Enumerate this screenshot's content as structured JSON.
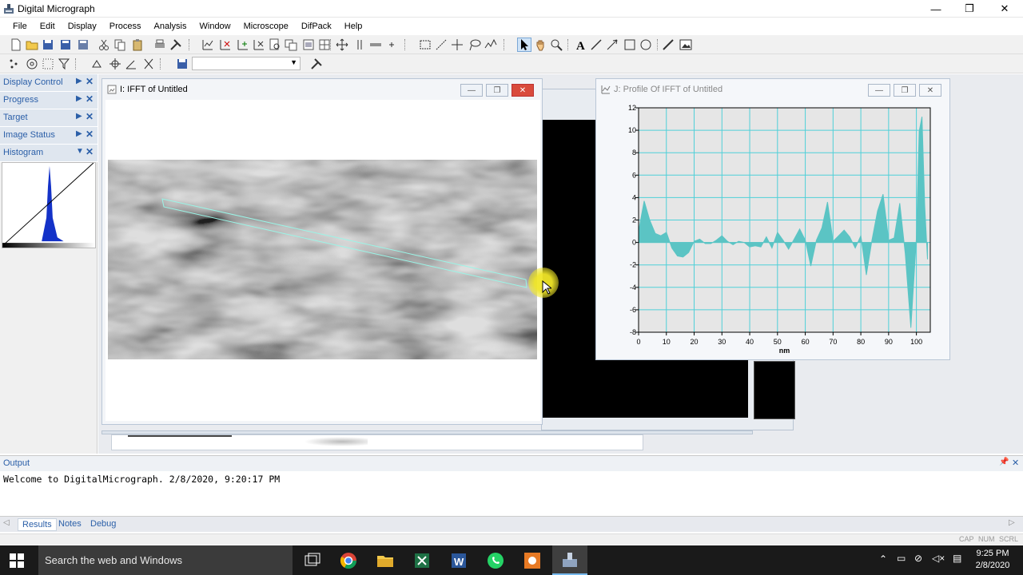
{
  "app": {
    "title": "Digital Micrograph"
  },
  "menu": [
    "File",
    "Edit",
    "Display",
    "Process",
    "Analysis",
    "Window",
    "Microscope",
    "DifPack",
    "Help"
  ],
  "palette": {
    "items": [
      {
        "label": "Display Control",
        "arrow": "▶"
      },
      {
        "label": "Progress",
        "arrow": "▶"
      },
      {
        "label": "Target",
        "arrow": "▶"
      },
      {
        "label": "Image Status",
        "arrow": "▶"
      },
      {
        "label": "Histogram",
        "arrow": "▼"
      }
    ],
    "close": "✕"
  },
  "windows": {
    "ifft": {
      "title": "I: IFFT of Untitled"
    },
    "profile": {
      "title": "J: Profile Of IFFT of Untitled"
    }
  },
  "chart_data": {
    "type": "area",
    "title": "",
    "xlabel": "nm",
    "ylabel": "",
    "xlim": [
      0,
      105
    ],
    "ylim": [
      -8,
      12
    ],
    "xticks": [
      0,
      10,
      20,
      30,
      40,
      50,
      60,
      70,
      80,
      90,
      100
    ],
    "yticks": [
      -8,
      -6,
      -4,
      -2,
      0,
      2,
      4,
      6,
      8,
      10,
      12
    ],
    "grid": true,
    "color": "#5bc4c4",
    "series": [
      {
        "x": [
          0,
          2,
          4,
          6,
          8,
          10,
          12,
          14,
          16,
          18,
          20,
          22,
          24,
          26,
          28,
          30,
          32,
          34,
          36,
          38,
          40,
          42,
          44,
          46,
          48,
          50,
          52,
          54,
          56,
          58,
          60,
          62,
          64,
          66,
          68,
          70,
          72,
          74,
          76,
          78,
          80,
          82,
          84,
          86,
          88,
          90,
          92,
          94,
          96,
          98,
          100,
          101,
          102,
          103,
          104
        ],
        "y": [
          1,
          3.7,
          2,
          0.8,
          0.6,
          0.9,
          -0.5,
          -1.2,
          -1.3,
          -0.9,
          0.1,
          0.3,
          -0.1,
          -0.1,
          0.2,
          0.6,
          0.1,
          -0.2,
          0.1,
          0,
          -0.4,
          -0.3,
          -0.4,
          0.5,
          -0.5,
          0.9,
          0.2,
          -0.6,
          0.3,
          1.2,
          0.2,
          -2.1,
          0.2,
          1.3,
          3.6,
          0.1,
          0.6,
          1.1,
          0.5,
          -0.5,
          0.6,
          -2.9,
          0.2,
          2.8,
          4.3,
          0.2,
          0.4,
          3.5,
          -1,
          -7.6,
          0.4,
          9.9,
          11.2,
          3.3,
          -1.5
        ]
      }
    ]
  },
  "output": {
    "label": "Output",
    "text": "Welcome to DigitalMicrograph.  2/8/2020, 9:20:17 PM",
    "tabs": [
      "Results",
      "Notes",
      "Debug"
    ]
  },
  "statusbar": {
    "indicators": [
      "CAP",
      "NUM",
      "SCRL"
    ]
  },
  "taskbar": {
    "search_placeholder": "Search the web and Windows",
    "time": "9:25 PM",
    "date": "2/8/2020"
  }
}
